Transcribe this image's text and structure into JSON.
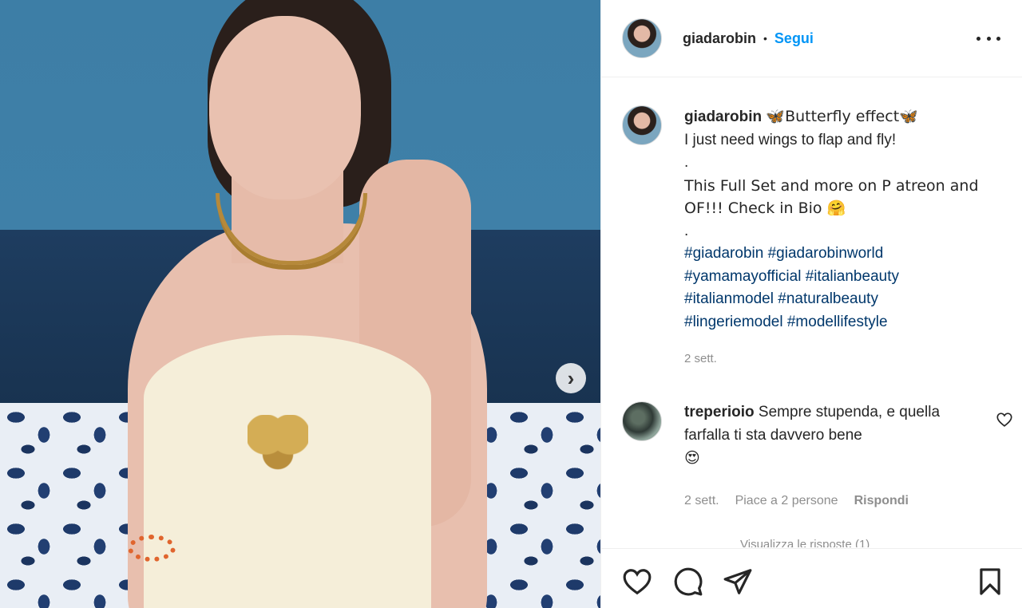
{
  "post": {
    "username": "giadarobin",
    "follow_label": "Segui",
    "separator": "•",
    "caption_title": "🦋Butterfly effect🦋",
    "caption_lines": [
      "I just need wings to flap and fly!",
      ".",
      "This Full Set and more on P atreon and OF!!! Check in Bio 🤗",
      "."
    ],
    "hashtags": [
      "#giadarobin",
      "#giadarobinworld",
      "#yamamayofficial",
      "#italianbeauty",
      "#italianmodel",
      "#naturalbeauty",
      "#lingeriemodel",
      "#modellifestyle"
    ],
    "time": "2 sett."
  },
  "comment": {
    "username": "treperioio",
    "text": "Sempre stupenda, e quella farfalla ti sta davvero bene",
    "emoji": "😍",
    "time": "2 sett.",
    "likes": "Piace a 2 persone",
    "reply_label": "Rispondi",
    "view_replies": "Visualizza le risposte (1)"
  },
  "carousel": {
    "next_icon": "chevron-right-icon",
    "next_glyph": "›"
  },
  "icons": {
    "more": "more-options-icon",
    "like": "heart-icon",
    "comment": "comment-icon",
    "share": "paper-plane-icon",
    "save": "bookmark-icon"
  },
  "colors": {
    "link": "#0095f6",
    "hashtag": "#00376b",
    "muted": "#8e8e8e",
    "text": "#262626"
  }
}
